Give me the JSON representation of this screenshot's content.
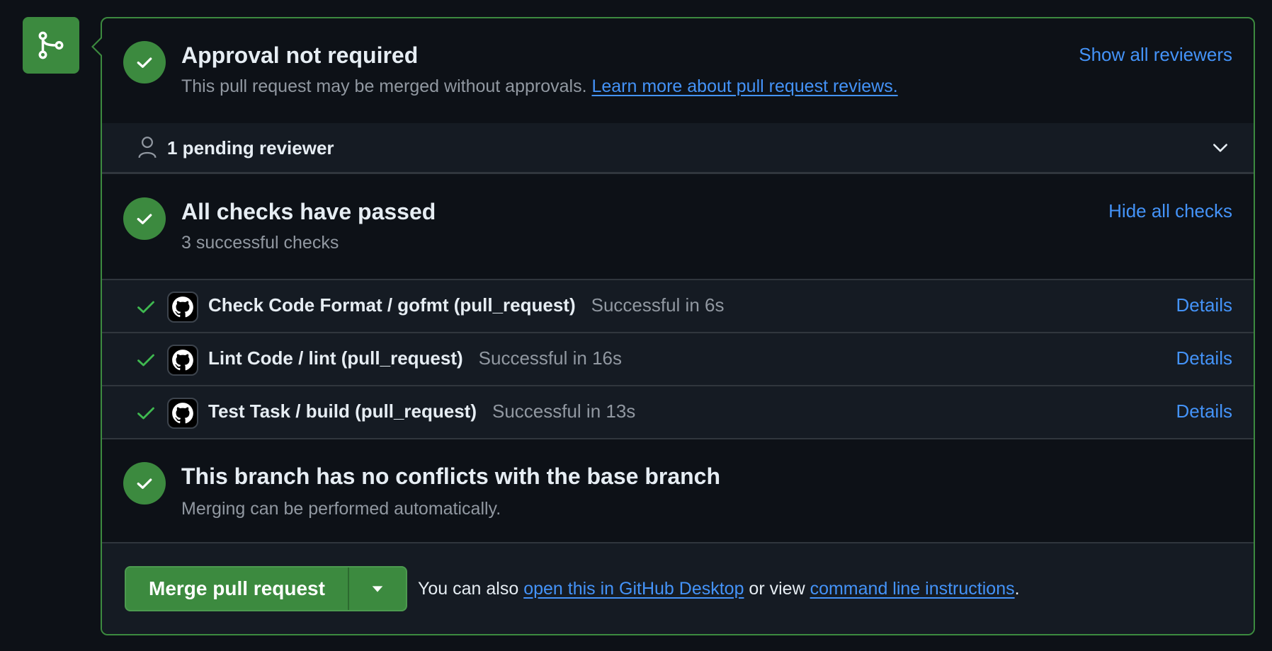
{
  "approval": {
    "title": "Approval not required",
    "subtitle": "This pull request may be merged without approvals.",
    "learn_more": "Learn more about pull request reviews.",
    "show_all_reviewers": "Show all reviewers"
  },
  "pending": {
    "label": "1 pending reviewer"
  },
  "checks": {
    "title": "All checks have passed",
    "subtitle": "3 successful checks",
    "hide_all": "Hide all checks",
    "items": [
      {
        "name": "Check Code Format / gofmt (pull_request)",
        "status": "Successful in 6s",
        "details": "Details"
      },
      {
        "name": "Lint Code / lint (pull_request)",
        "status": "Successful in 16s",
        "details": "Details"
      },
      {
        "name": "Test Task / build (pull_request)",
        "status": "Successful in 13s",
        "details": "Details"
      }
    ]
  },
  "conflicts": {
    "title": "This branch has no conflicts with the base branch",
    "subtitle": "Merging can be performed automatically."
  },
  "merge": {
    "button_label": "Merge pull request",
    "also_prefix": "You can also ",
    "desktop_link": "open this in GitHub Desktop",
    "or_view": " or view ",
    "cli_link": "command line instructions",
    "suffix": "."
  },
  "colors": {
    "success_green": "#3c8a3f",
    "link_blue": "#4493f8",
    "background": "#0d1117"
  },
  "icons": [
    "git-merge-icon",
    "check-icon",
    "person-icon",
    "chevron-down-icon",
    "github-logo-icon",
    "triangle-down-icon"
  ]
}
